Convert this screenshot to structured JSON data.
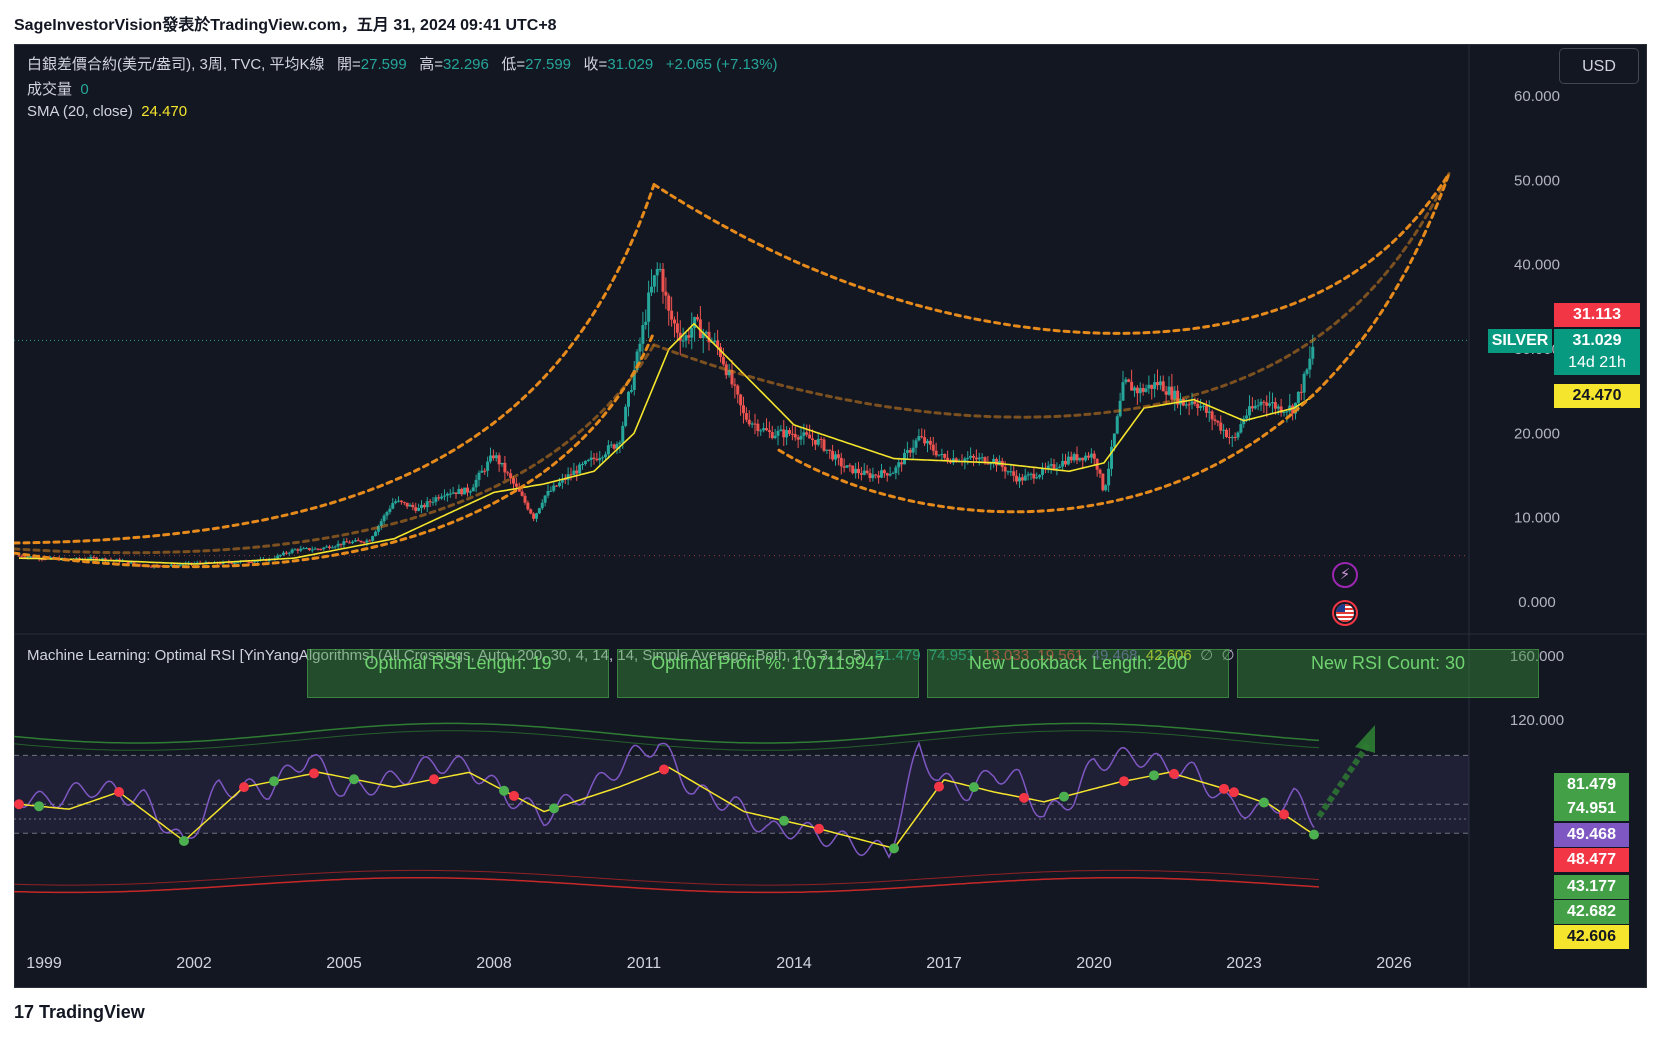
{
  "header": {
    "caption": "SageInvestorVision發表於TradingView.com，五月 31, 2024 09:41 UTC+8"
  },
  "legend": {
    "symbol": "白銀差價合約(美元/盎司), 3周, TVC, 平均K線",
    "open_label": "開=",
    "open": "27.599",
    "high_label": "高=",
    "high": "32.296",
    "low_label": "低=",
    "low": "27.599",
    "close_label": "收=",
    "close": "31.029",
    "change": "+2.065 (+7.13%)",
    "volume_label": "成交量",
    "volume": "0",
    "sma_label": "SMA (20, close)",
    "sma": "24.470"
  },
  "indicator_legend": {
    "name": "Machine Learning: Optimal RSI [YinYangAlgorithms] (All Crossings, Auto, 200, 30, 4, 14, 14, Simple Average, Both, 10, 3, 1, 5)",
    "v1": "81.479",
    "v2": "74.951",
    "v3": "13.033",
    "v4": "19.561",
    "v5": "49.468",
    "v6": "42.606",
    "v7": "∅",
    "v8": "∅"
  },
  "info_boxes": [
    "Optimal RSI Length: 19",
    "Optimal Profit %: 1.07119947",
    "New Lookback Length: 200",
    "New RSI Count: 30"
  ],
  "currency_button": "USD",
  "price_badges": {
    "high": "31.113",
    "symbol": "SILVER",
    "price": "31.029",
    "countdown": "14d 21h",
    "sma": "24.470"
  },
  "rsi_badges": [
    "81.479",
    "74.951",
    "49.468",
    "48.477",
    "43.177",
    "42.682",
    "42.606"
  ],
  "colors": {
    "bg": "#131722",
    "up": "#26a69a",
    "down": "#ef5350",
    "sma": "#f5e52c",
    "channel": "#e68a1c",
    "rsi": "#7e57c2",
    "rsi_avg": "#f5e52c",
    "band_up": "#2e7d32",
    "band_down": "#c62828",
    "high_badge": "#f23645",
    "price_badge": "#089981"
  },
  "icons": [
    "lightning-icon",
    "us-flag-icon",
    "arrow-up-icon"
  ],
  "footer": {
    "logo": "TradingView"
  },
  "chart_data": [
    {
      "type": "line",
      "title": "",
      "x_ticks": [
        "1999",
        "2002",
        "2005",
        "2008",
        "2011",
        "2014",
        "2017",
        "2020",
        "2023",
        "2026"
      ],
      "y_ticks": [
        "0.000",
        "10.000",
        "20.000",
        "30.000",
        "40.000",
        "50.000",
        "60.000"
      ],
      "ylim": [
        0,
        60
      ],
      "xlim": [
        1998.4,
        2028.4
      ],
      "grid": false,
      "series": [
        {
          "name": "",
          "x": [
            1998.5,
            1999,
            1999.5,
            2000,
            2000.5,
            2001,
            2001.5,
            2002,
            2002.5,
            2003,
            2003.5,
            2004,
            2004.5,
            2005,
            2005.5,
            2006,
            2006.5,
            2007,
            2007.5,
            2008,
            2008.5,
            2008.8,
            2009,
            2009.5,
            2010,
            2010.5,
            2010.9,
            2011.1,
            2011.3,
            2011.5,
            2011.8,
            2012,
            2012.5,
            2013,
            2013.5,
            2014,
            2014.5,
            2015,
            2015.5,
            2016,
            2016.5,
            2017,
            2017.5,
            2018,
            2018.5,
            2019,
            2019.5,
            2020,
            2020.2,
            2020.6,
            2020.9,
            2021.3,
            2021.8,
            2022,
            2022.5,
            2022.8,
            2023,
            2023.4,
            2023.7,
            2024,
            2024.3,
            2024.4
          ],
          "y": [
            5.5,
            5.2,
            5.0,
            5.2,
            4.9,
            4.3,
            4.3,
            4.6,
            4.6,
            4.8,
            5.0,
            6.2,
            6.3,
            7.0,
            7.3,
            12.0,
            11.0,
            13.0,
            13.2,
            17.5,
            13.0,
            10.0,
            12.5,
            15.0,
            17.0,
            19.0,
            30.0,
            36.0,
            40.0,
            34.0,
            31.0,
            33.0,
            30.0,
            22.0,
            20.0,
            20.0,
            19.0,
            16.0,
            15.0,
            15.5,
            19.5,
            17.0,
            17.0,
            16.8,
            14.5,
            15.5,
            17.0,
            17.5,
            13.0,
            26.0,
            25.0,
            26.0,
            23.5,
            24.0,
            21.0,
            19.0,
            22.0,
            24.0,
            23.0,
            23.0,
            28.0,
            31.029
          ]
        },
        {
          "name": "",
          "x": [
            1998.5,
            2000,
            2002,
            2004,
            2006,
            2008,
            2009,
            2010,
            2010.8,
            2011.5,
            2012,
            2013,
            2014,
            2016,
            2018,
            2019.5,
            2020.2,
            2021,
            2022,
            2023,
            2024,
            2024.4
          ],
          "y": [
            5.2,
            5.0,
            4.5,
            5.2,
            7.5,
            13.0,
            14.0,
            15.5,
            20.0,
            30.0,
            33.0,
            27.0,
            21.0,
            17.0,
            16.5,
            15.5,
            16.5,
            23.0,
            24.0,
            21.5,
            23.0,
            24.47
          ]
        }
      ]
    },
    {
      "type": "line",
      "title": "",
      "y_ticks": [
        "120.000",
        "160.000"
      ],
      "series": [
        {
          "name": "",
          "x": [
            1998.5,
            1999,
            2000,
            2001,
            2001.8,
            2002.5,
            2003.5,
            2004.3,
            2005,
            2006,
            2006.8,
            2007.5,
            2008.3,
            2009,
            2010,
            2010.8,
            2011.3,
            2012,
            2012.8,
            2013.5,
            2014,
            2015,
            2015.9,
            2016.5,
            2016.9,
            2017.5,
            2018,
            2018.5,
            2019,
            2019.6,
            2020,
            2020.8,
            2021.5,
            2022,
            2022.7,
            2023.3,
            2024,
            2024.4
          ],
          "y": [
            58,
            56,
            62,
            57,
            38,
            62,
            61,
            75,
            60,
            65,
            72,
            70,
            58,
            50,
            62,
            75,
            80,
            60,
            55,
            44,
            45,
            40,
            35,
            78,
            65,
            60,
            68,
            65,
            50,
            58,
            72,
            75,
            70,
            68,
            55,
            52,
            58,
            49.468
          ]
        },
        {
          "name": "",
          "x": [
            1998.5,
            1999.5,
            2000.5,
            2001.8,
            2003,
            2004.5,
            2006,
            2007.5,
            2009,
            2010.5,
            2011.5,
            2013,
            2014.5,
            2016,
            2017,
            2018,
            2019,
            2020.5,
            2021.5,
            2022.5,
            2023.5,
            2024.4
          ],
          "y": [
            55,
            53,
            60,
            40,
            62,
            68,
            62,
            68,
            52,
            62,
            70,
            52,
            45,
            37,
            65,
            60,
            56,
            64,
            68,
            62,
            55,
            42.606
          ]
        }
      ]
    }
  ]
}
